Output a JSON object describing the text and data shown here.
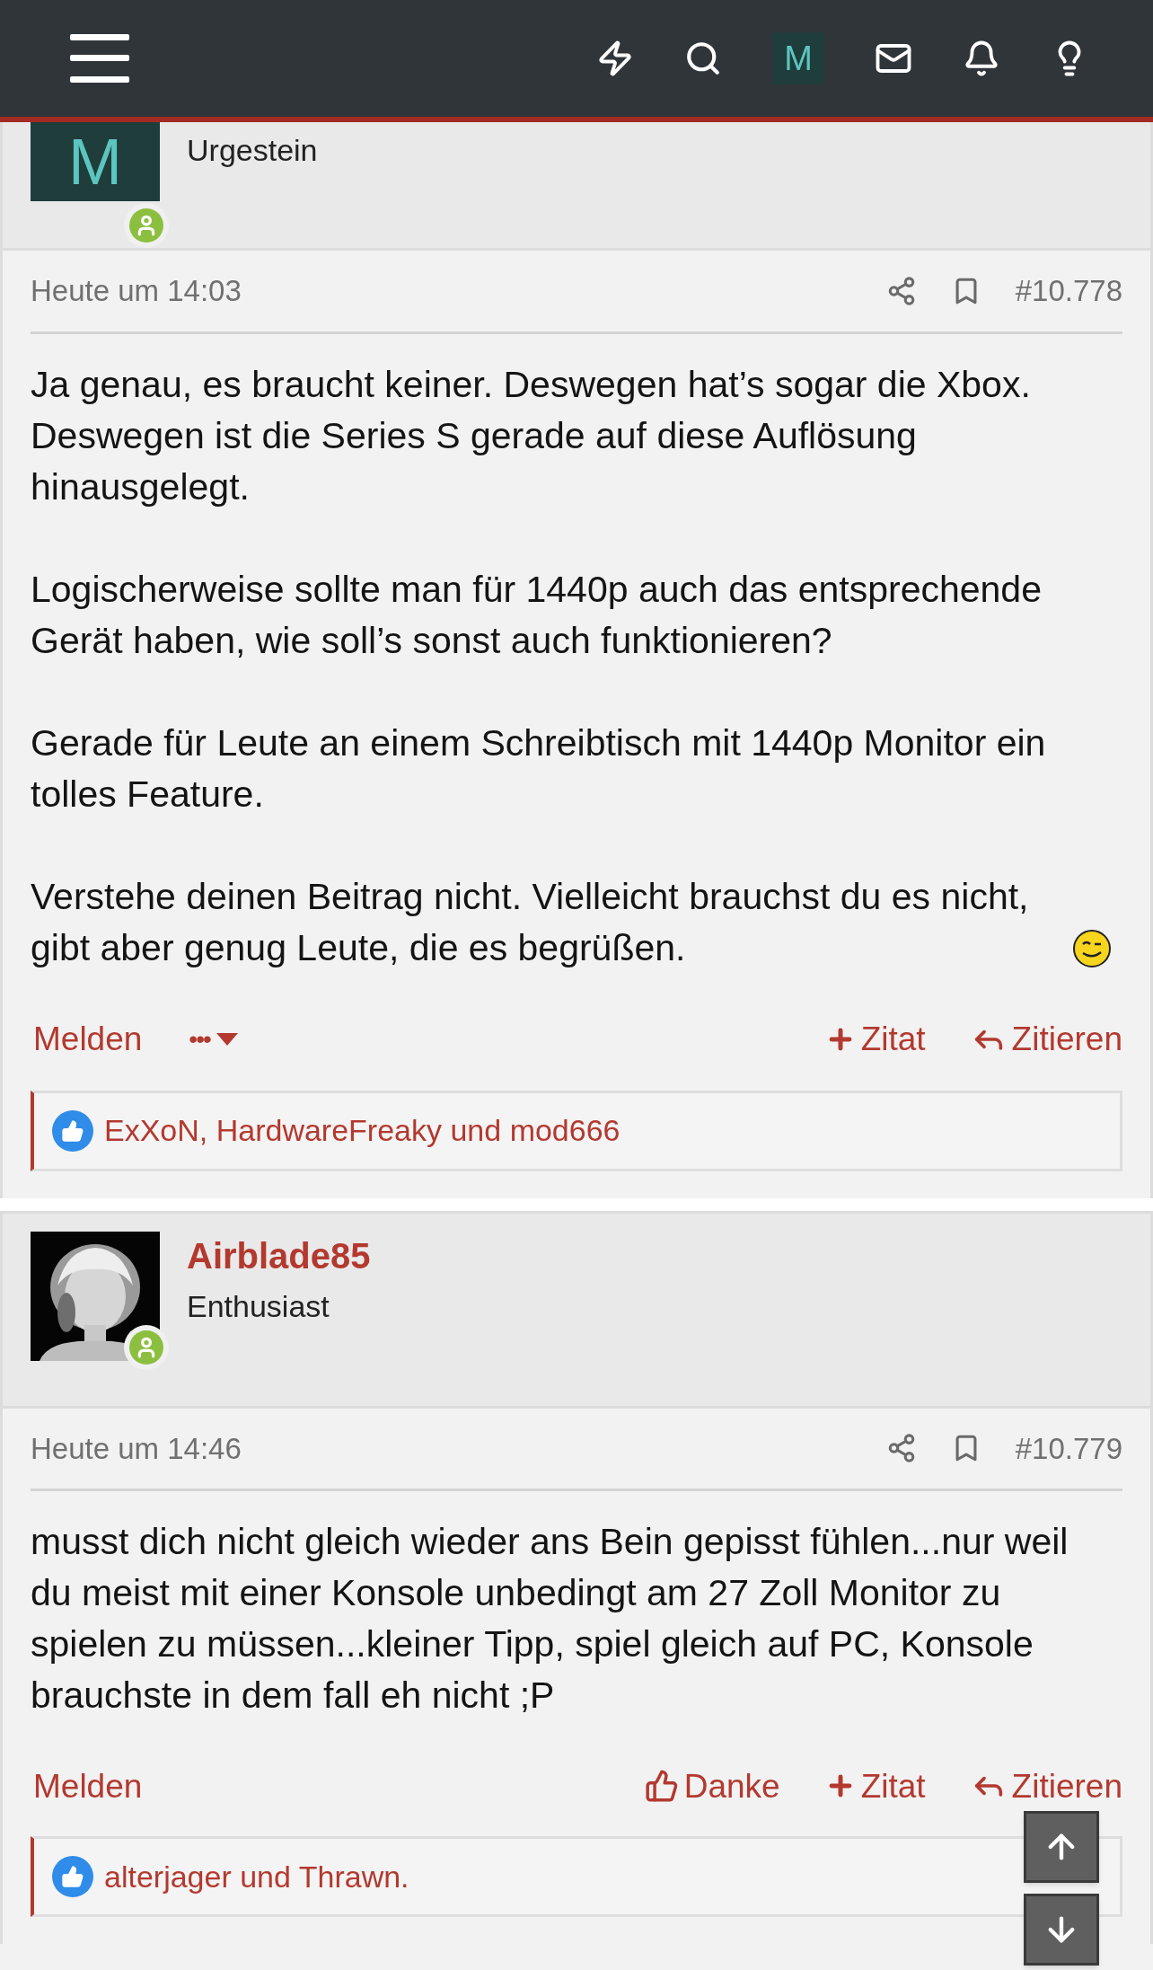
{
  "top_bar": {
    "nav_icons": [
      {
        "kind": "lightning"
      },
      {
        "kind": "search"
      },
      {
        "kind": "avatar",
        "letter": "M"
      },
      {
        "kind": "mail"
      },
      {
        "kind": "bell"
      },
      {
        "kind": "bulb"
      }
    ]
  },
  "posts": [
    {
      "user": {
        "avatar": {
          "kind": "letter",
          "letter": "M"
        },
        "title": "Urgestein",
        "online": true
      },
      "date": "Heute um 14:03",
      "number": "#10.778",
      "paragraphs": [
        {
          "text": "Ja genau, es braucht keiner. Deswegen hat’s sogar die Xbox. Deswegen ist die Series S gerade auf diese Auflösung hinausgelegt."
        },
        {
          "text": "Logischerweise sollte man für 1440p auch das entsprechende Gerät haben, wie soll’s sonst auch funktionieren?"
        },
        {
          "text": "Gerade für Leute an einem Schreibtisch mit 1440p Monitor ein tolles Feature."
        },
        {
          "text": "Verstehe deinen Beitrag nicht. Vielleicht brauchst du es nicht, gibt aber genug Leute, die es begrüßen.",
          "smiley": true
        }
      ],
      "actions_left": [
        {
          "kind": "report",
          "label": "Melden"
        },
        {
          "kind": "more",
          "label": "•••"
        }
      ],
      "actions_right": [
        {
          "kind": "multiquote",
          "label": "Zitat"
        },
        {
          "kind": "reply",
          "label": "Zitieren"
        }
      ],
      "likes": "ExXoN, HardwareFreaky und mod666"
    },
    {
      "user": {
        "name": "Airblade85",
        "title": "Enthusiast",
        "online": true
      },
      "date": "Heute um 14:46",
      "number": "#10.779",
      "paragraphs": [
        {
          "text": "musst dich nicht gleich wieder ans Bein gepisst fühlen...nur weil du meist mit einer Konsole unbedingt am 27 Zoll Monitor zu spielen zu müssen...kleiner Tipp, spiel gleich auf PC, Konsole brauchste in dem fall eh nicht ;P"
        }
      ],
      "actions_left": [
        {
          "kind": "report",
          "label": "Melden"
        }
      ],
      "actions_right": [
        {
          "kind": "like",
          "label": "Danke"
        },
        {
          "kind": "multiquote",
          "label": "Zitat"
        },
        {
          "kind": "reply",
          "label": "Zitieren"
        }
      ],
      "likes": "alterjager und Thrawn."
    }
  ]
}
